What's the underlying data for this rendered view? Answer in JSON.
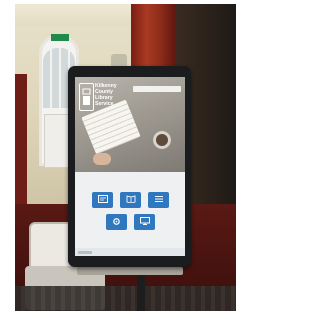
{
  "kiosk": {
    "logo_line1": "Kilkenny",
    "logo_line2": "County",
    "logo_line3": "Library",
    "logo_line4": "Service"
  },
  "tiles": [
    {
      "icon": "catalogue-icon"
    },
    {
      "icon": "ebook-icon"
    },
    {
      "icon": "list-icon"
    },
    {
      "icon": "gear-icon"
    },
    {
      "icon": "monitor-icon"
    }
  ],
  "colors": {
    "tile_blue": "#2f77bf",
    "kiosk_frame": "#1b1c1e",
    "pillar_red": "#a83a22",
    "floor_red": "#4a1410"
  }
}
